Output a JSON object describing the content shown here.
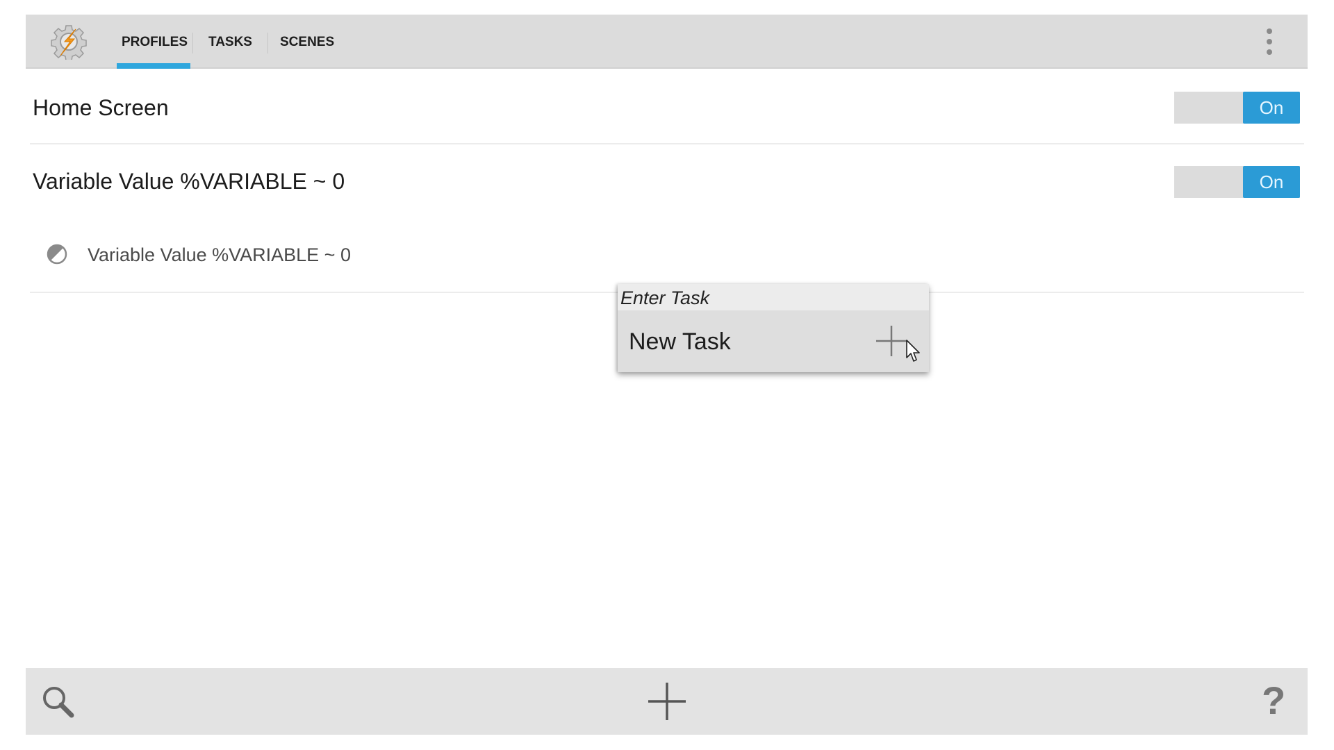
{
  "header": {
    "tabs": [
      {
        "label": "PROFILES",
        "active": true
      },
      {
        "label": "TASKS",
        "active": false
      },
      {
        "label": "SCENES",
        "active": false
      }
    ],
    "accent_color": "#2ea6dd"
  },
  "profiles": [
    {
      "name": "Home Screen",
      "toggle": "On"
    },
    {
      "name": "Variable Value %VARIABLE ~ 0",
      "toggle": "On",
      "context": "Variable Value %VARIABLE ~ 0"
    }
  ],
  "popup": {
    "title": "Enter Task",
    "item": "New Task"
  },
  "icons": {
    "logo": "tasker-logo",
    "menu": "overflow-menu-icon",
    "search": "search-icon",
    "add": "plus-icon",
    "help": "help-icon"
  }
}
